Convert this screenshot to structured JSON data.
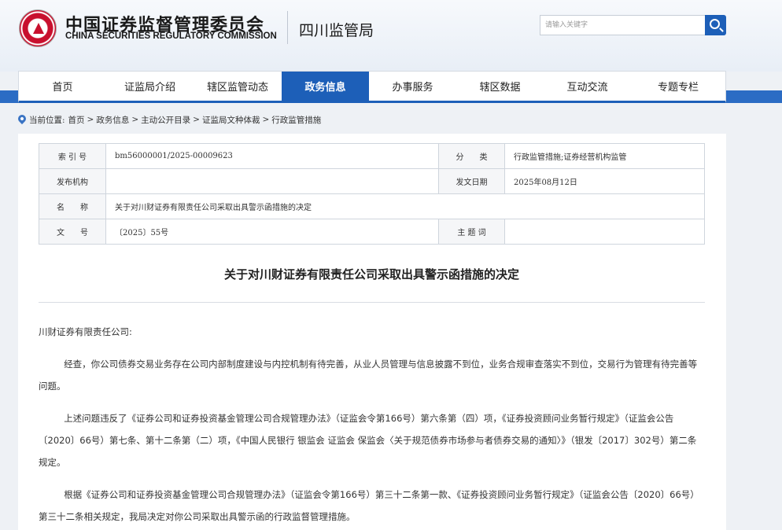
{
  "header": {
    "logo_cn": "中国证券监督管理委员会",
    "logo_en": "CHINA SECURITIES REGULATORY COMMISSION",
    "bureau": "四川监管局",
    "search_placeholder": "请输入关键字",
    "search_icon": "search-icon"
  },
  "nav": {
    "items": [
      "首页",
      "证监局介绍",
      "辖区监管动态",
      "政务信息",
      "办事服务",
      "辖区数据",
      "互动交流",
      "专题专栏"
    ],
    "active_index": 3
  },
  "breadcrumb": {
    "prefix": "当前位置:",
    "items": [
      "首页",
      "政务信息",
      "主动公开目录",
      "证监局文种体裁",
      "行政监管措施"
    ],
    "separator": ">"
  },
  "meta": {
    "index_label": "索 引 号",
    "index_value": "bm56000001/2025-00009623",
    "category_label": "分　　类",
    "category_value": "行政监管措施;证券经营机构监管",
    "issuer_label": "发布机构",
    "issuer_value": "",
    "date_label": "发文日期",
    "date_value": "2025年08月12日",
    "name_label": "名　　称",
    "name_value": "关于对川财证券有限责任公司采取出具警示函措施的决定",
    "docno_label": "文　　号",
    "docno_value": "〔2025〕55号",
    "subject_label": "主 题 词",
    "subject_value": ""
  },
  "document": {
    "title": "关于对川财证券有限责任公司采取出具警示函措施的决定",
    "addressee": "川财证券有限责任公司:",
    "paragraphs": [
      "经查，你公司债券交易业务存在公司内部制度建设与内控机制有待完善，从业人员管理与信息披露不到位，业务合规审查落实不到位，交易行为管理有待完善等问题。",
      "上述问题违反了《证券公司和证券投资基金管理公司合规管理办法》（证监会令第166号）第六条第（四）项，《证券投资顾问业务暂行规定》（证监会公告〔2020〕66号）第七条、第十二条第（二）项，《中国人民银行 银监会 证监会 保监会〈关于规范债券市场参与者债券交易的通知〉》（银发〔2017〕302号）第二条规定。",
      "根据《证券公司和证券投资基金管理公司合规管理办法》（证监会令第166号）第三十二条第一款、《证券投资顾问业务暂行规定》（证监会公告〔2020〕66号）第三十二条相关规定，我局决定对你公司采取出具警示函的行政监督管理措施。"
    ]
  },
  "colors": {
    "primary_blue": "#1d5fb8",
    "band_blue": "#2b6cc4",
    "logo_red": "#c8102e"
  }
}
